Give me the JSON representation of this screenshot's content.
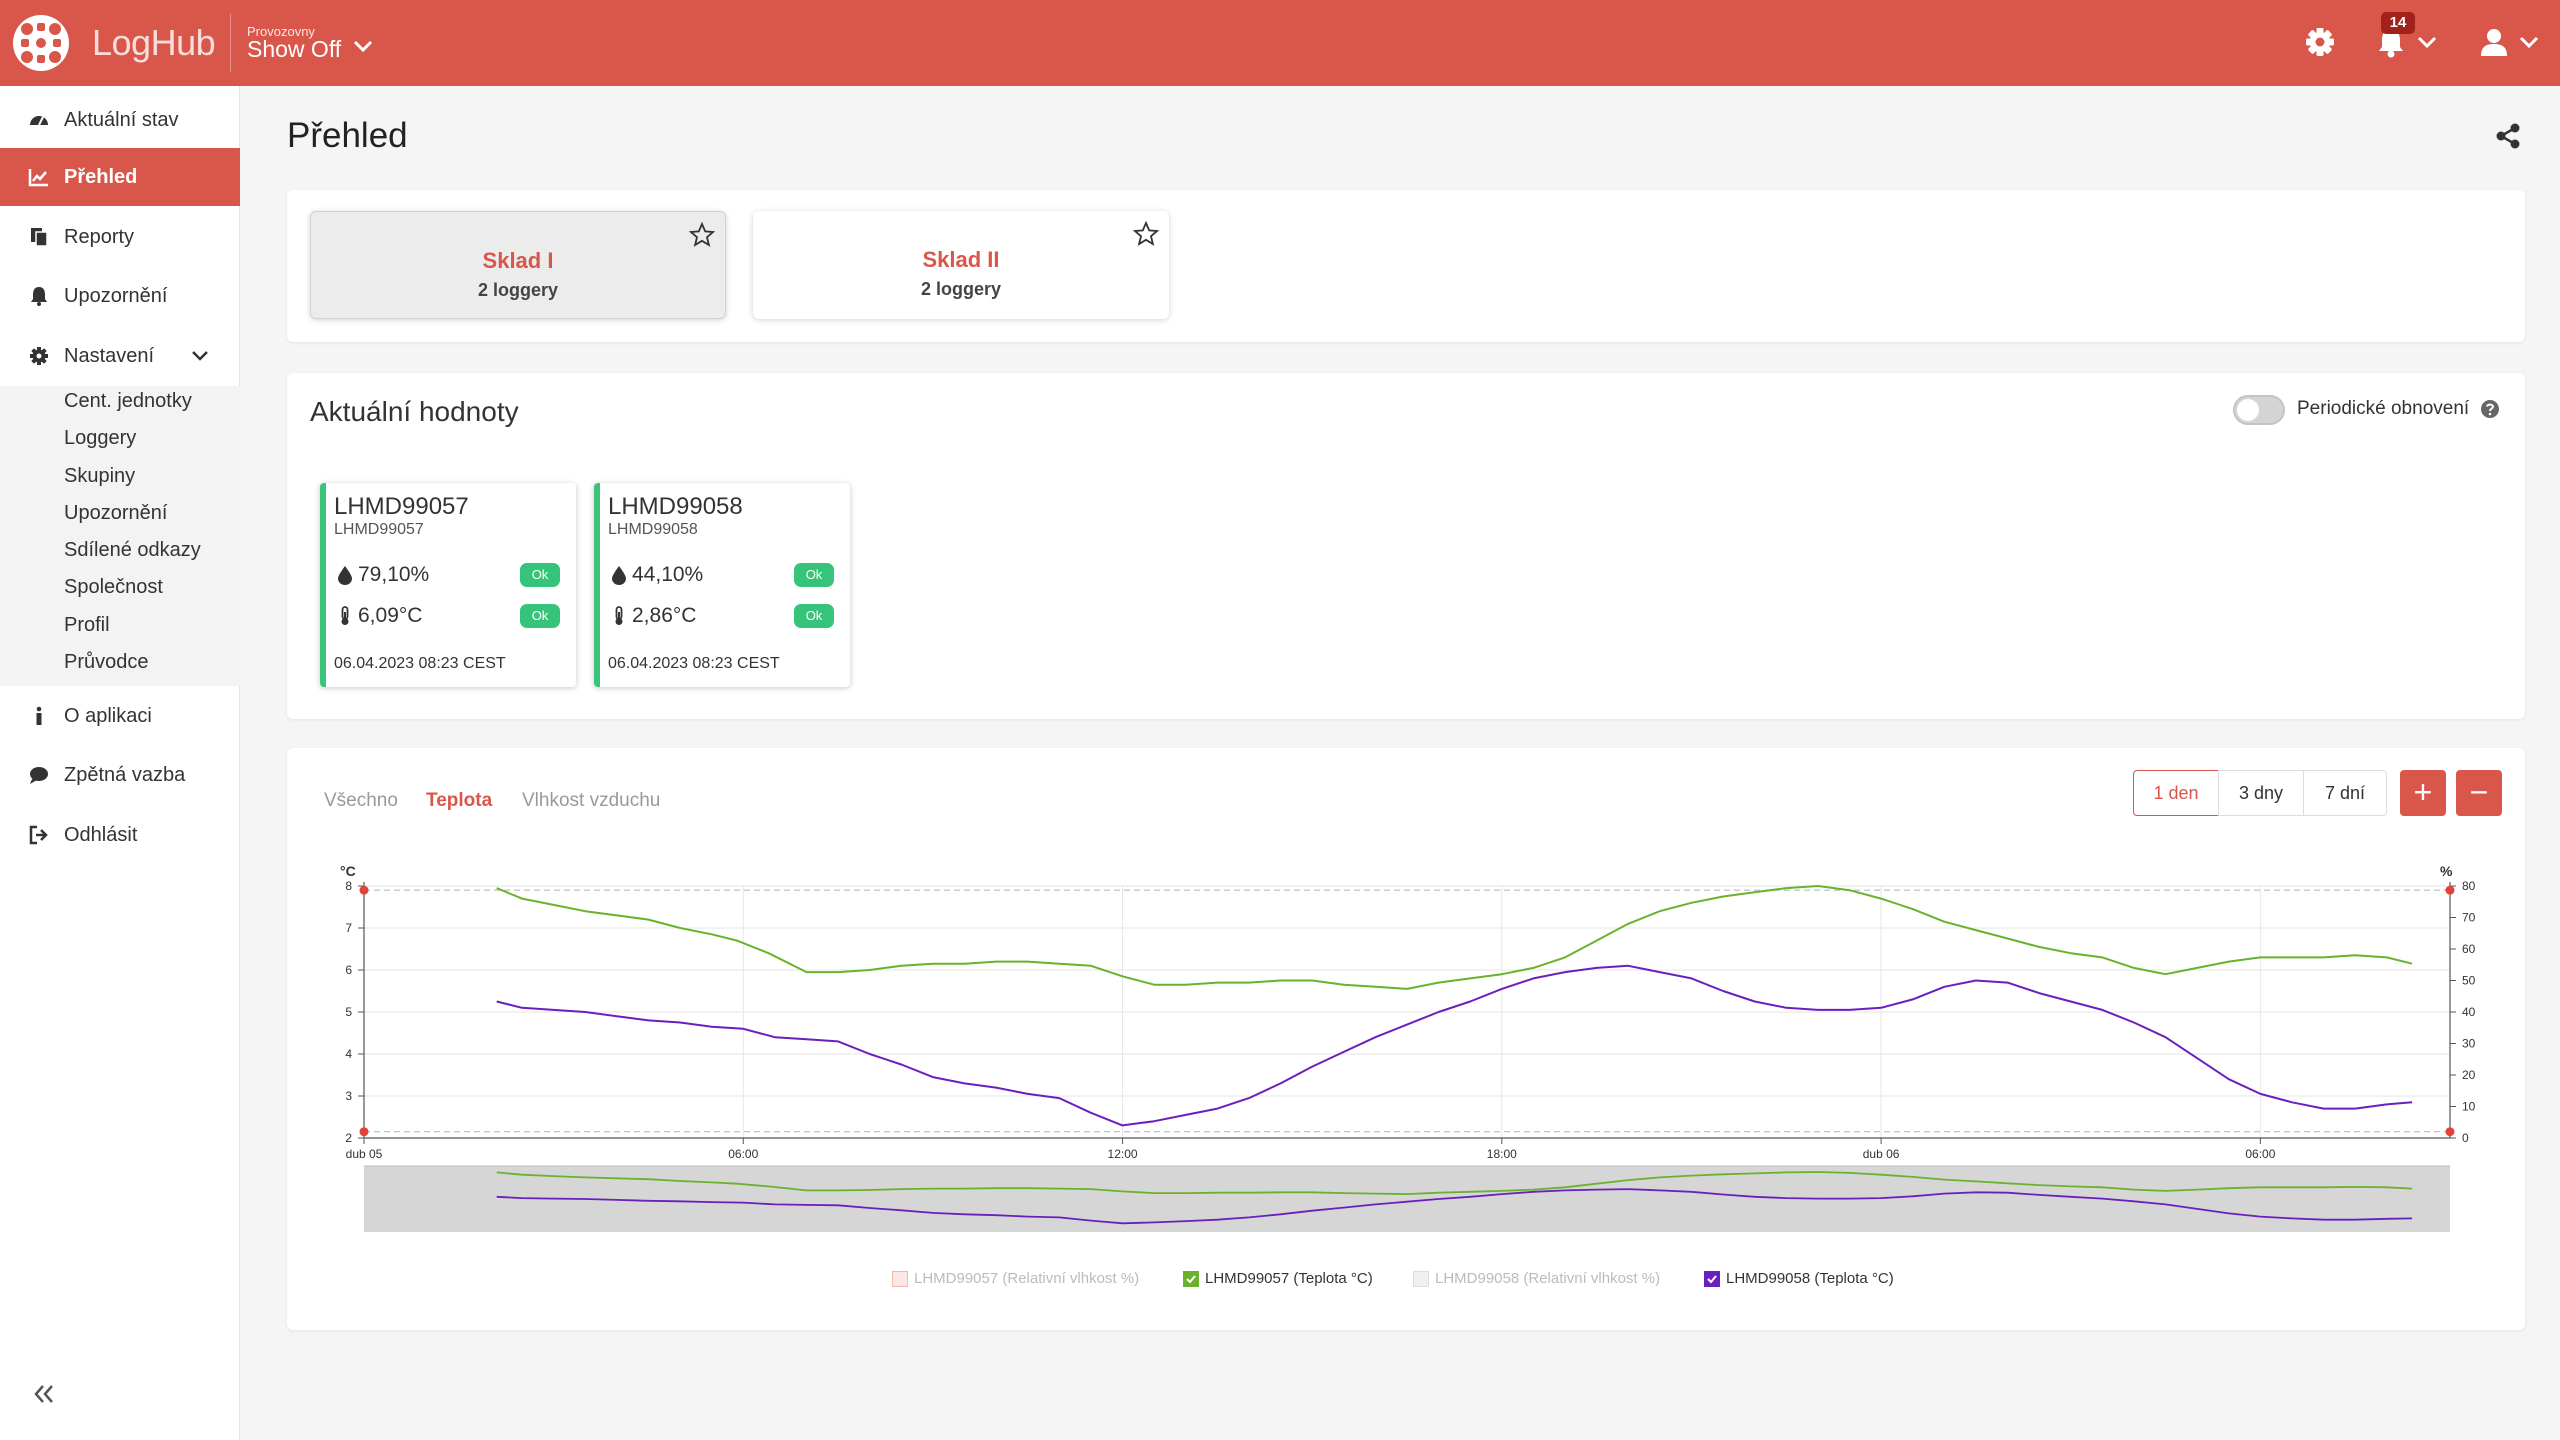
{
  "app": {
    "brand": "LogHub",
    "org_caption": "Provozovny",
    "org_name": "Show Off",
    "notifications_count": "14"
  },
  "sidebar": {
    "items": [
      {
        "label": "Aktuální stav",
        "icon": "dashboard-icon"
      },
      {
        "label": "Přehled",
        "icon": "line-chart-icon",
        "active": true
      },
      {
        "label": "Reporty",
        "icon": "files-icon"
      },
      {
        "label": "Upozornění",
        "icon": "bell-icon"
      },
      {
        "label": "Nastavení",
        "icon": "gear-icon",
        "expanded": true
      }
    ],
    "settings_items": [
      "Cent. jednotky",
      "Loggery",
      "Skupiny",
      "Upozornění",
      "Sdílené odkazy",
      "Společnost",
      "Profil",
      "Průvodce"
    ],
    "bottom_items": [
      {
        "label": "O aplikaci",
        "icon": "info-icon"
      },
      {
        "label": "Zpětná vazba",
        "icon": "comments-icon"
      },
      {
        "label": "Odhlásit",
        "icon": "sign-out-icon"
      }
    ]
  },
  "page": {
    "title": "Přehled"
  },
  "groups": [
    {
      "name": "Sklad I",
      "count": "2 loggery",
      "selected": true
    },
    {
      "name": "Sklad II",
      "count": "2 loggery",
      "selected": false
    }
  ],
  "current_values": {
    "title": "Aktuální hodnoty",
    "refresh_label": "Periodické obnovení",
    "refresh_on": false,
    "loggers": [
      {
        "name": "LHMD99057",
        "id": "LHMD99057",
        "humidity": "79,10%",
        "temperature": "6,09°C",
        "humidity_status": "Ok",
        "temperature_status": "Ok",
        "timestamp": "06.04.2023 08:23 CEST"
      },
      {
        "name": "LHMD99058",
        "id": "LHMD99058",
        "humidity": "44,10%",
        "temperature": "2,86°C",
        "humidity_status": "Ok",
        "temperature_status": "Ok",
        "timestamp": "06.04.2023 08:23 CEST"
      }
    ]
  },
  "chart_panel": {
    "tabs": [
      "Všechno",
      "Teplota",
      "Vlhkost vzduchu"
    ],
    "active_tab": "Teplota",
    "ranges": [
      "1 den",
      "3 dny",
      "7 dní"
    ],
    "active_range": "1 den",
    "zoom_in": "+",
    "zoom_out": "−"
  },
  "colors": {
    "accent": "#d9574a",
    "ok": "#36c47a",
    "series_green": "#6ab22e",
    "series_purple": "#6a1fbf"
  },
  "chart_data": {
    "type": "line",
    "y_left": {
      "label": "°C",
      "ticks": [
        "2",
        "3",
        "4",
        "5",
        "6",
        "7",
        "8"
      ],
      "range": [
        2,
        8
      ]
    },
    "y_right": {
      "label": "%",
      "ticks": [
        "0",
        "10",
        "20",
        "30",
        "40",
        "50",
        "60",
        "70",
        "80"
      ],
      "range": [
        0,
        80
      ]
    },
    "x_ticks": [
      {
        "h": 0,
        "label": "dub 05"
      },
      {
        "h": 6,
        "label": "06:00"
      },
      {
        "h": 12,
        "label": "12:00"
      },
      {
        "h": 18,
        "label": "18:00"
      },
      {
        "h": 24,
        "label": "dub 06"
      },
      {
        "h": 30,
        "label": "06:00"
      }
    ],
    "x_range_hours": [
      0,
      33
    ],
    "legend": [
      {
        "label": "LHMD99057 (Relativní vlhkost %)",
        "color": "#f3b5b0",
        "visible": false
      },
      {
        "label": "LHMD99057 (Teplota °C)",
        "color": "#6ab22e",
        "visible": true
      },
      {
        "label": "LHMD99058 (Relativní vlhkost %)",
        "color": "#bdbdbd",
        "visible": false
      },
      {
        "label": "LHMD99058 (Teplota °C)",
        "color": "#6a1fbf",
        "visible": true
      }
    ],
    "series": [
      {
        "name": "LHMD99057 (Teplota °C)",
        "color": "#6ab22e",
        "x": [
          2.1,
          2.5,
          3,
          3.5,
          4,
          4.5,
          5,
          5.5,
          5.9,
          6.4,
          7,
          7.5,
          8,
          8.5,
          9,
          9.5,
          10,
          10.5,
          11,
          11.5,
          12,
          12.5,
          13,
          13.5,
          14,
          14.5,
          15,
          15.5,
          16,
          16.5,
          17,
          17.5,
          18,
          18.5,
          19,
          19.5,
          20,
          20.5,
          21,
          21.5,
          22,
          22.5,
          23,
          23.5,
          24,
          24.5,
          25,
          25.5,
          26,
          26.5,
          27,
          27.5,
          28,
          28.5,
          29,
          29.5,
          30,
          30.5,
          31,
          31.5,
          32,
          32.4
        ],
        "y": [
          7.95,
          7.7,
          7.55,
          7.4,
          7.3,
          7.2,
          7.0,
          6.85,
          6.7,
          6.4,
          5.95,
          5.95,
          6.0,
          6.1,
          6.15,
          6.15,
          6.2,
          6.2,
          6.15,
          6.1,
          5.85,
          5.65,
          5.65,
          5.7,
          5.7,
          5.75,
          5.75,
          5.65,
          5.6,
          5.55,
          5.7,
          5.8,
          5.9,
          6.05,
          6.3,
          6.7,
          7.1,
          7.4,
          7.6,
          7.75,
          7.85,
          7.95,
          8.0,
          7.9,
          7.7,
          7.45,
          7.15,
          6.95,
          6.75,
          6.55,
          6.4,
          6.3,
          6.05,
          5.9,
          6.05,
          6.2,
          6.3,
          6.3,
          6.3,
          6.35,
          6.3,
          6.15
        ]
      },
      {
        "name": "LHMD99058 (Teplota °C)",
        "color": "#6a1fbf",
        "x": [
          2.1,
          2.5,
          3,
          3.5,
          4,
          4.5,
          5,
          5.5,
          6,
          6.5,
          7,
          7.5,
          8,
          8.5,
          9,
          9.5,
          10,
          10.5,
          11,
          11.5,
          12,
          12.5,
          13,
          13.5,
          14,
          14.5,
          15,
          15.5,
          16,
          16.5,
          17,
          17.5,
          18,
          18.5,
          19,
          19.5,
          20,
          20.5,
          21,
          21.5,
          22,
          22.5,
          23,
          23.5,
          24,
          24.5,
          25,
          25.5,
          26,
          26.5,
          27,
          27.5,
          28,
          28.5,
          29,
          29.5,
          30,
          30.5,
          31,
          31.5,
          32,
          32.4
        ],
        "y": [
          5.25,
          5.1,
          5.05,
          5.0,
          4.9,
          4.8,
          4.75,
          4.65,
          4.6,
          4.4,
          4.35,
          4.3,
          4.0,
          3.75,
          3.45,
          3.3,
          3.2,
          3.05,
          2.95,
          2.6,
          2.3,
          2.4,
          2.55,
          2.7,
          2.95,
          3.3,
          3.7,
          4.05,
          4.4,
          4.7,
          5.0,
          5.25,
          5.55,
          5.8,
          5.95,
          6.05,
          6.1,
          5.95,
          5.8,
          5.5,
          5.25,
          5.1,
          5.05,
          5.05,
          5.1,
          5.3,
          5.6,
          5.75,
          5.7,
          5.45,
          5.25,
          5.05,
          4.75,
          4.4,
          3.9,
          3.4,
          3.05,
          2.85,
          2.7,
          2.7,
          2.8,
          2.85
        ]
      }
    ]
  }
}
